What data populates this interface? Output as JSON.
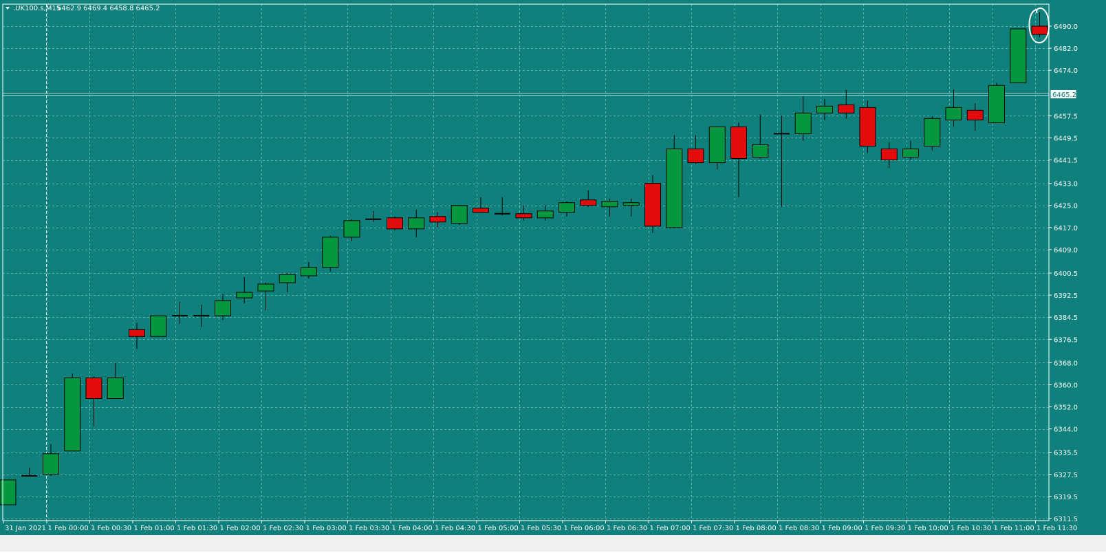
{
  "header": {
    "symbol": ".UK100.s,M15",
    "ohlc": "6462.9 6469.4 6458.8 6465.2"
  },
  "price_tag": "6465.2",
  "colors": {
    "background": "#0f807b",
    "grid": "#7fc4bf",
    "bull": "#04973f",
    "bear": "#e20c0c",
    "axis_text": "#ffffff",
    "candle_outline": "#000000",
    "price_line": "#b9d9d6",
    "annotation": "#ffffff"
  },
  "chart_data": {
    "type": "candlestick",
    "symbol": ".UK100.s",
    "timeframe": "M15",
    "ylim": [
      6311.5,
      6498.0
    ],
    "y_ticks": [
      "6490.0",
      "6482.0",
      "6474.0",
      "6457.5",
      "6449.5",
      "6441.5",
      "6433.0",
      "6425.0",
      "6417.0",
      "6409.0",
      "6400.5",
      "6392.5",
      "6384.5",
      "6376.5",
      "6368.0",
      "6360.0",
      "6352.0",
      "6344.0",
      "6335.5",
      "6327.5",
      "6319.5",
      "6311.5"
    ],
    "x_ticks": [
      "31 Jan 2021",
      "1 Feb 00:00",
      "1 Feb 00:30",
      "1 Feb 01:00",
      "1 Feb 01:30",
      "1 Feb 02:00",
      "1 Feb 02:30",
      "1 Feb 03:00",
      "1 Feb 03:30",
      "1 Feb 04:00",
      "1 Feb 04:30",
      "1 Feb 05:00",
      "1 Feb 05:30",
      "1 Feb 06:00",
      "1 Feb 06:30",
      "1 Feb 07:00",
      "1 Feb 07:30",
      "1 Feb 08:00",
      "1 Feb 08:30",
      "1 Feb 09:00",
      "1 Feb 09:30",
      "1 Feb 10:00",
      "1 Feb 10:30",
      "1 Feb 11:00",
      "1 Feb 11:30"
    ],
    "current_price": 6465.2,
    "candles": [
      {
        "o": 6316.5,
        "h": 6325.5,
        "l": 6316.5,
        "c": 6325.5
      },
      {
        "o": 6327.0,
        "h": 6330.0,
        "l": 6327.0,
        "c": 6327.0
      },
      {
        "o": 6327.5,
        "h": 6338.5,
        "l": 6327.0,
        "c": 6335.0
      },
      {
        "o": 6336.0,
        "h": 6364.0,
        "l": 6336.0,
        "c": 6362.5
      },
      {
        "o": 6362.5,
        "h": 6363.0,
        "l": 6345.0,
        "c": 6355.0
      },
      {
        "o": 6355.0,
        "h": 6368.0,
        "l": 6355.0,
        "c": 6362.5
      },
      {
        "o": 6380.0,
        "h": 6382.5,
        "l": 6373.0,
        "c": 6377.5
      },
      {
        "o": 6377.5,
        "h": 6385.0,
        "l": 6377.5,
        "c": 6385.0
      },
      {
        "o": 6385.0,
        "h": 6390.0,
        "l": 6382.0,
        "c": 6385.0
      },
      {
        "o": 6385.0,
        "h": 6389.0,
        "l": 6381.0,
        "c": 6385.0
      },
      {
        "o": 6385.0,
        "h": 6393.0,
        "l": 6383.5,
        "c": 6390.5
      },
      {
        "o": 6391.5,
        "h": 6399.0,
        "l": 6389.5,
        "c": 6393.5
      },
      {
        "o": 6394.0,
        "h": 6397.0,
        "l": 6387.0,
        "c": 6396.5
      },
      {
        "o": 6397.0,
        "h": 6400.5,
        "l": 6393.5,
        "c": 6400.0
      },
      {
        "o": 6399.5,
        "h": 6404.5,
        "l": 6398.5,
        "c": 6402.5
      },
      {
        "o": 6402.5,
        "h": 6414.0,
        "l": 6401.0,
        "c": 6413.5
      },
      {
        "o": 6413.5,
        "h": 6420.0,
        "l": 6412.0,
        "c": 6419.5
      },
      {
        "o": 6420.0,
        "h": 6423.0,
        "l": 6419.0,
        "c": 6420.0
      },
      {
        "o": 6420.5,
        "h": 6421.0,
        "l": 6416.0,
        "c": 6416.5
      },
      {
        "o": 6416.5,
        "h": 6423.5,
        "l": 6413.5,
        "c": 6420.5
      },
      {
        "o": 6421.0,
        "h": 6422.5,
        "l": 6417.0,
        "c": 6419.0
      },
      {
        "o": 6418.5,
        "h": 6425.0,
        "l": 6418.0,
        "c": 6425.0
      },
      {
        "o": 6424.0,
        "h": 6428.0,
        "l": 6422.5,
        "c": 6422.5
      },
      {
        "o": 6422.0,
        "h": 6428.0,
        "l": 6421.5,
        "c": 6422.0
      },
      {
        "o": 6422.0,
        "h": 6425.0,
        "l": 6419.5,
        "c": 6420.5
      },
      {
        "o": 6420.5,
        "h": 6425.0,
        "l": 6419.5,
        "c": 6423.0
      },
      {
        "o": 6422.5,
        "h": 6426.5,
        "l": 6421.0,
        "c": 6426.0
      },
      {
        "o": 6427.0,
        "h": 6430.5,
        "l": 6424.5,
        "c": 6425.0
      },
      {
        "o": 6424.5,
        "h": 6427.5,
        "l": 6421.0,
        "c": 6426.5
      },
      {
        "o": 6425.0,
        "h": 6427.5,
        "l": 6421.0,
        "c": 6426.0
      },
      {
        "o": 6433.0,
        "h": 6436.0,
        "l": 6415.0,
        "c": 6417.5
      },
      {
        "o": 6417.0,
        "h": 6450.5,
        "l": 6417.0,
        "c": 6445.5
      },
      {
        "o": 6445.5,
        "h": 6450.5,
        "l": 6440.0,
        "c": 6440.5
      },
      {
        "o": 6440.5,
        "h": 6453.5,
        "l": 6438.0,
        "c": 6453.5
      },
      {
        "o": 6453.5,
        "h": 6455.0,
        "l": 6428.0,
        "c": 6442.0
      },
      {
        "o": 6442.5,
        "h": 6458.0,
        "l": 6442.0,
        "c": 6447.0
      },
      {
        "o": 6451.0,
        "h": 6457.5,
        "l": 6424.5,
        "c": 6451.0
      },
      {
        "o": 6451.0,
        "h": 6464.5,
        "l": 6448.5,
        "c": 6458.5
      },
      {
        "o": 6458.5,
        "h": 6463.5,
        "l": 6456.0,
        "c": 6461.0
      },
      {
        "o": 6461.5,
        "h": 6467.0,
        "l": 6456.5,
        "c": 6458.5
      },
      {
        "o": 6460.5,
        "h": 6463.0,
        "l": 6444.0,
        "c": 6446.5
      },
      {
        "o": 6445.5,
        "h": 6448.0,
        "l": 6438.5,
        "c": 6441.5
      },
      {
        "o": 6442.5,
        "h": 6448.5,
        "l": 6441.5,
        "c": 6445.5
      },
      {
        "o": 6446.5,
        "h": 6457.5,
        "l": 6445.0,
        "c": 6456.5
      },
      {
        "o": 6456.0,
        "h": 6467.0,
        "l": 6453.5,
        "c": 6460.5
      },
      {
        "o": 6459.5,
        "h": 6462.0,
        "l": 6452.0,
        "c": 6456.0
      },
      {
        "o": 6455.0,
        "h": 6469.5,
        "l": 6455.0,
        "c": 6468.5
      },
      {
        "o": 6469.5,
        "h": 6489.0,
        "l": 6469.5,
        "c": 6489.0
      },
      {
        "o": 6490.0,
        "h": 6495.0,
        "l": 6486.0,
        "c": 6487.0
      }
    ]
  }
}
